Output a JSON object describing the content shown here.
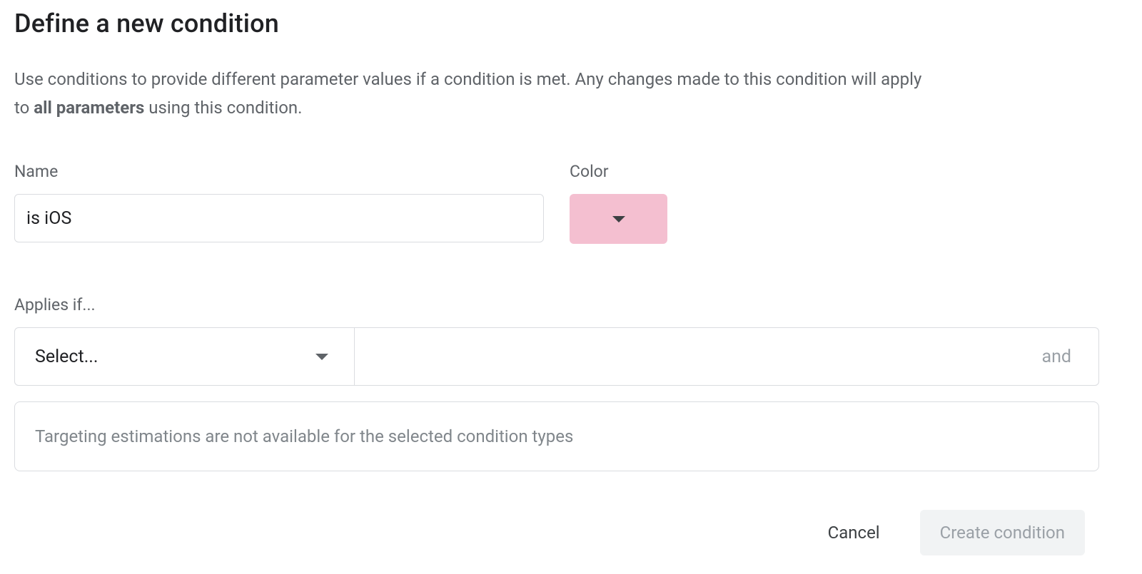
{
  "title": "Define a new condition",
  "description": {
    "part1": "Use conditions to provide different parameter values if a condition is met. Any changes made to this condition will apply to ",
    "bold": "all parameters",
    "part2": " using this condition."
  },
  "fields": {
    "name_label": "Name",
    "name_value": "is iOS",
    "color_label": "Color",
    "color_value": "#f4bfd0"
  },
  "applies": {
    "label": "Applies if...",
    "select_placeholder": "Select...",
    "and_label": "and"
  },
  "info_message": "Targeting estimations are not available for the selected condition types",
  "buttons": {
    "cancel": "Cancel",
    "create": "Create condition"
  }
}
